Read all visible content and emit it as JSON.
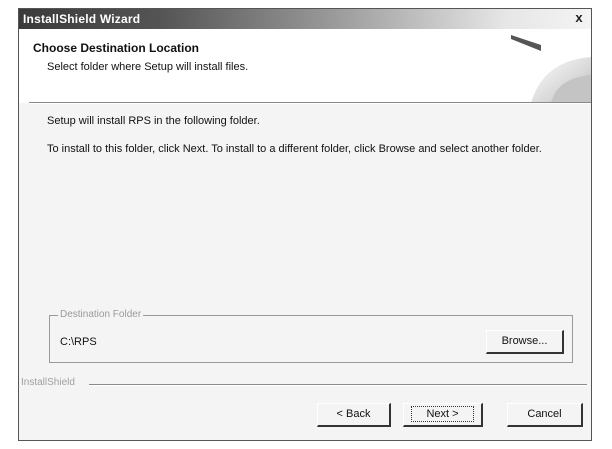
{
  "window": {
    "title": "InstallShield Wizard",
    "close_glyph": "x"
  },
  "header": {
    "title": "Choose Destination Location",
    "subtitle": "Select folder where Setup will install files."
  },
  "body": {
    "line1": "Setup will install RPS in the following folder.",
    "line2": "To install to this folder, click Next. To install to a different folder, click Browse and select another folder."
  },
  "destination": {
    "legend": "Destination Folder",
    "path": "C:\\RPS",
    "browse_label": "Browse..."
  },
  "footer": {
    "brand": "InstallShield",
    "back_label": "< Back",
    "next_label": "Next >",
    "cancel_label": "Cancel"
  },
  "icons": {
    "close": "close-icon",
    "header_graphic": "installshield-header-graphic"
  }
}
